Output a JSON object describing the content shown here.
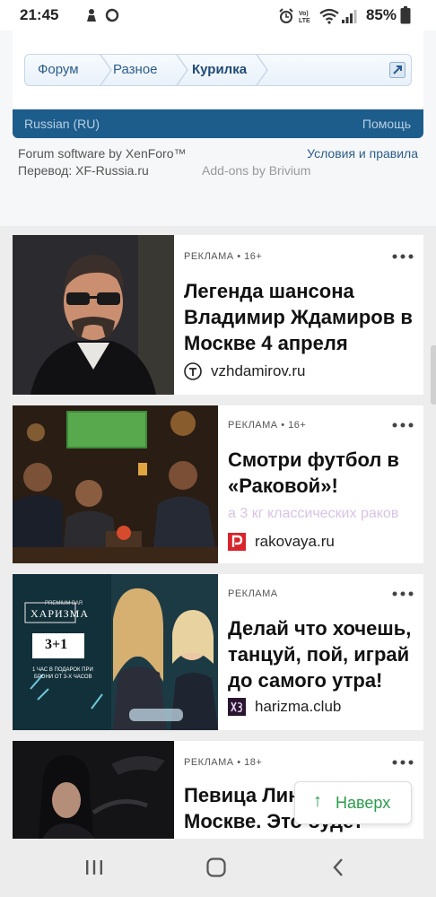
{
  "status_bar": {
    "time": "21:45",
    "battery_percent": "85%",
    "icons": [
      "worker-notification-icon",
      "chat-bubble-icon",
      "alarm-icon",
      "volte-icon",
      "wifi-icon",
      "signal-icon",
      "battery-icon"
    ]
  },
  "breadcrumb": {
    "items": [
      "Форум",
      "Разное",
      "Курилка"
    ],
    "jump_icon": "external-jump-icon"
  },
  "footer": {
    "language": "Russian (RU)",
    "help": "Помощь",
    "software": "Forum software by XenForo™",
    "translation": "Перевод: XF-Russia.ru",
    "terms": "Условия и правила",
    "addons": "Add-ons by Brivium"
  },
  "ads": [
    {
      "meta": "РЕКЛАМА • 16+",
      "title": "Легенда шансона Владимир Ждамиров в Москве 4 апреля",
      "description": "",
      "source": "vzhdamirov.ru",
      "favicon": "t-circle-icon"
    },
    {
      "meta": "РЕКЛАМА • 16+",
      "title": "Смотри футбол в «Раковой»!",
      "description": "а 3 кг классических раков",
      "source": "rakovaya.ru",
      "favicon": "p-red-icon"
    },
    {
      "meta": "РЕКЛАМА",
      "title": "Делай что хочешь, танцуй, пой, играй до самого утра!",
      "description": "",
      "source": "harizma.club",
      "favicon": "x3-dark-icon",
      "image_text": {
        "brand_small": "PREMIUM BAR",
        "brand": "ХАРИЗМА",
        "offer": "3+1",
        "line1": "1 ЧАС В ПОДАРОК ПРИ",
        "line2": "БРОНИ ОТ 3-Х ЧАСОВ"
      }
    },
    {
      "meta": "РЕКЛАМА • 18+",
      "title": "Певица Лина в Москве. Это будет",
      "description": "",
      "source": "",
      "favicon": ""
    }
  ],
  "up_button": {
    "arrow": "↑",
    "label": "Наверх"
  },
  "nav_bar": {
    "buttons": [
      "recent-apps-icon",
      "home-icon",
      "back-icon"
    ]
  },
  "colors": {
    "forum_blue": "#1d5d8c",
    "link_blue": "#2b5d8c",
    "up_green": "#2a9d4a",
    "feed_bg": "#ededed"
  }
}
